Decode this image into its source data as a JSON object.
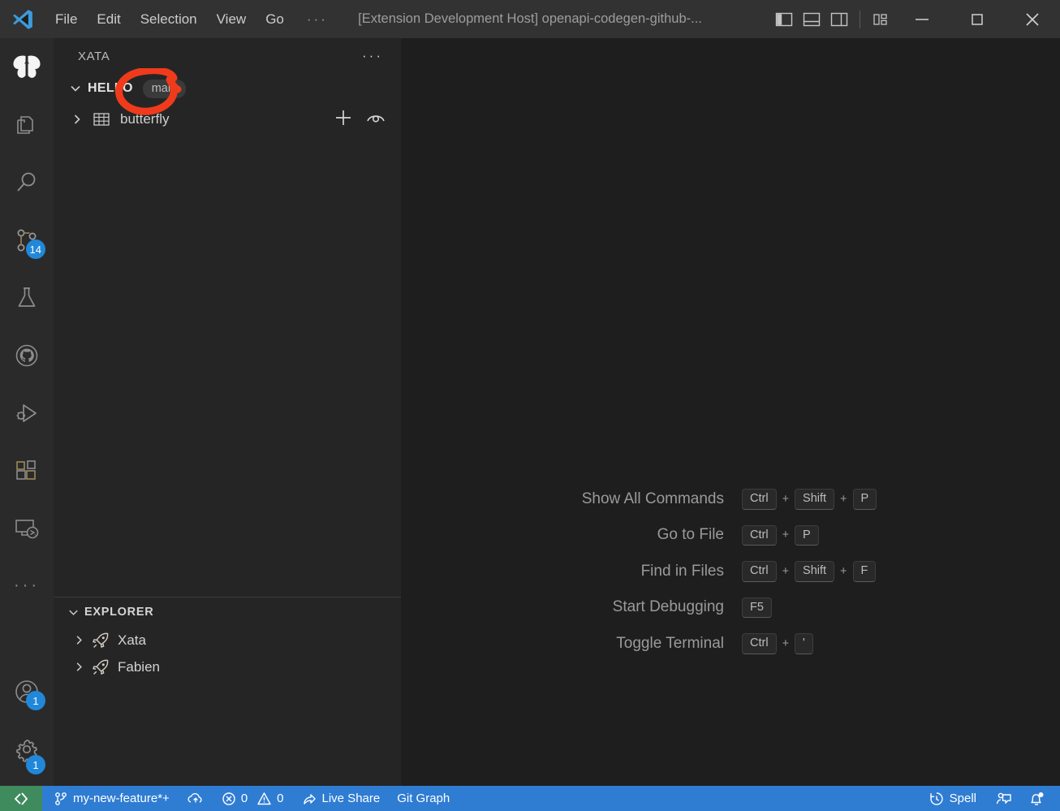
{
  "titlebar": {
    "logo_icon": "vscode-logo-icon",
    "menu": [
      {
        "label": "File"
      },
      {
        "label": "Edit"
      },
      {
        "label": "Selection"
      },
      {
        "label": "View"
      },
      {
        "label": "Go"
      },
      {
        "label": "···"
      }
    ],
    "window_title": "[Extension Development Host] openapi-codegen-github-...",
    "layout_buttons": [
      {
        "name": "toggle-primary-sidebar-icon"
      },
      {
        "name": "toggle-panel-icon"
      },
      {
        "name": "toggle-secondary-sidebar-icon"
      },
      {
        "name": "customize-layout-icon"
      }
    ],
    "window_controls": [
      {
        "name": "minimize-button",
        "glyph": "—"
      },
      {
        "name": "maximize-button",
        "glyph": "☐"
      },
      {
        "name": "close-button",
        "glyph": "✕"
      }
    ]
  },
  "activitybar": {
    "items": [
      {
        "name": "xata-butterfly-icon",
        "label": "Xata",
        "badge": null
      },
      {
        "name": "explorer-icon",
        "label": "Explorer",
        "badge": null
      },
      {
        "name": "search-icon",
        "label": "Search",
        "badge": null
      },
      {
        "name": "source-control-icon",
        "label": "Source Control",
        "badge": "14"
      },
      {
        "name": "testing-flask-icon",
        "label": "Testing",
        "badge": null
      },
      {
        "name": "github-icon",
        "label": "GitHub",
        "badge": null
      },
      {
        "name": "run-and-debug-icon",
        "label": "Run and Debug",
        "badge": null
      },
      {
        "name": "extensions-icon",
        "label": "Extensions",
        "badge": null
      },
      {
        "name": "remote-explorer-icon",
        "label": "Remote Explorer",
        "badge": null
      },
      {
        "name": "additional-views-icon",
        "label": "···",
        "badge": null
      }
    ],
    "bottom": [
      {
        "name": "accounts-icon",
        "label": "Accounts",
        "badge": "1"
      },
      {
        "name": "settings-gear-icon",
        "label": "Manage",
        "badge": "1"
      }
    ]
  },
  "sidebar": {
    "xata": {
      "title": "XATA",
      "more_actions": "···",
      "database": {
        "name": "HELLO",
        "branch": "main",
        "expanded": true
      },
      "tables": [
        {
          "name": "butterfly",
          "expanded": false,
          "actions": [
            {
              "name": "add-record-icon",
              "glyph": "+"
            },
            {
              "name": "preview-table-icon",
              "glyph": "eye"
            }
          ]
        }
      ]
    },
    "explorer": {
      "title": "EXPLORER",
      "expanded": true,
      "items": [
        {
          "name": "Xata",
          "icon": "rocket-icon"
        },
        {
          "name": "Fabien",
          "icon": "rocket-icon"
        }
      ]
    }
  },
  "welcome": {
    "shortcuts": [
      {
        "label": "Show All Commands",
        "keys": [
          "Ctrl",
          "Shift",
          "P"
        ]
      },
      {
        "label": "Go to File",
        "keys": [
          "Ctrl",
          "P"
        ]
      },
      {
        "label": "Find in Files",
        "keys": [
          "Ctrl",
          "Shift",
          "F"
        ]
      },
      {
        "label": "Start Debugging",
        "keys": [
          "F5"
        ]
      },
      {
        "label": "Toggle Terminal",
        "keys": [
          "Ctrl",
          "'"
        ]
      }
    ],
    "key_separator": "+"
  },
  "statusbar": {
    "remote_icon": "remote-window-icon",
    "branch": "my-new-feature*+",
    "sync_icon": "sync-cloud-icon",
    "errors": "0",
    "warnings": "0",
    "live_share": "Live Share",
    "git_graph": "Git Graph",
    "spell": "Spell",
    "feedback_icon": "feedback-icon",
    "bell_icon": "notifications-bell-icon"
  },
  "annotation": {
    "type": "hand-drawn-circle",
    "color": "#ef3b1c",
    "target": "main"
  },
  "colors": {
    "titlebar_bg": "#323233",
    "activitybar_bg": "#2a2a2b",
    "sidebar_bg": "#252526",
    "editor_bg": "#1e1e1e",
    "statusbar_bg": "#2f7cd3",
    "remote_bg": "#3f8b5e",
    "badge_bg": "#2188d9",
    "annotation": "#ef3b1c"
  }
}
